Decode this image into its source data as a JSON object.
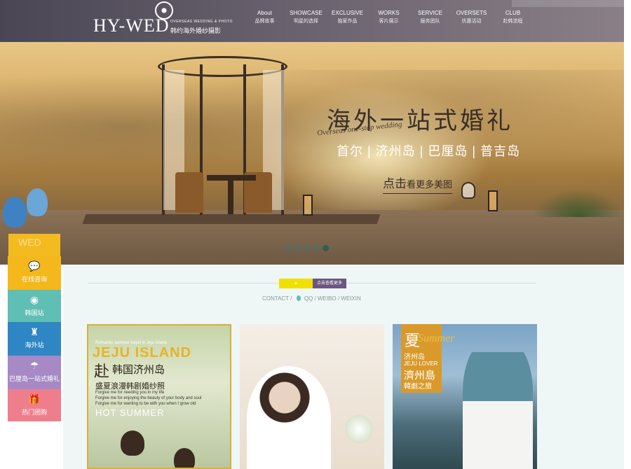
{
  "header": {
    "logo_text": "HY-WED",
    "logo_en": "OVERSEAS WEDDING & PHOTO",
    "logo_cn": "韩约海外婚纱摄影",
    "nav": [
      {
        "en": "About",
        "cn": "品牌故事"
      },
      {
        "en": "SHOWCASE",
        "cn": "明星的选择"
      },
      {
        "en": "EXCLUSIVE",
        "cn": "独家作品"
      },
      {
        "en": "WORKS",
        "cn": "客片展示"
      },
      {
        "en": "SERVICE",
        "cn": "服务团队"
      },
      {
        "en": "OVERSETS",
        "cn": "优惠活动"
      },
      {
        "en": "CLUB",
        "cn": "赴韩流程"
      }
    ]
  },
  "banner": {
    "title": "海外一站式婚礼",
    "subtitle_en": "Overseas one-stop wedding",
    "places": "首尔 | 济州岛 | 巴厘岛 | 普吉岛",
    "cta_big": "点击",
    "cta_rest": "看更多美图",
    "slide_count": 5,
    "active_slide": 5
  },
  "sidebar": {
    "watermark": "WED",
    "items": [
      {
        "icon": "chat-icon",
        "glyph": "💬",
        "label": "在线咨询",
        "color": "#f4b81c"
      },
      {
        "icon": "globe-icon",
        "glyph": "◉",
        "label": "韩国站",
        "color": "#5fbfb5"
      },
      {
        "icon": "eiffel-tower-icon",
        "glyph": "♜",
        "label": "海外站",
        "color": "#2f86c4"
      },
      {
        "icon": "palm-island-icon",
        "glyph": "☂",
        "label": "巴厘岛一站式婚礼",
        "color": "#a789c5"
      },
      {
        "icon": "gift-icon",
        "glyph": "🎁",
        "label": "热门团购",
        "color": "#ef7e8c"
      }
    ]
  },
  "content": {
    "plus_label": "+",
    "more_label": "点击查看更多",
    "contact_label": "CONTACT /",
    "links": "QQ / WEIBO / WEIXIN"
  },
  "cards": {
    "card1": {
      "en": "Romantic summer travel in Jeju Island",
      "island": "JEJU ISLAND",
      "go": "赴",
      "dest": "韩国济州岛",
      "sub": "盛夏浪漫韩剧婚纱照",
      "lines": [
        "Forgive me for needing you in my life",
        "Forgive me for enjoying the beauty of your body and soul",
        "Forgive me for wanting to be with you when I grow old"
      ],
      "hot": "HOT SUMMER"
    },
    "card3": {
      "xia": "夏",
      "summer": "Summer",
      "l1": "济州岛",
      "l2": "JEJU LOVER",
      "l3": "濟州島",
      "l4": "韓劇之旅"
    }
  }
}
